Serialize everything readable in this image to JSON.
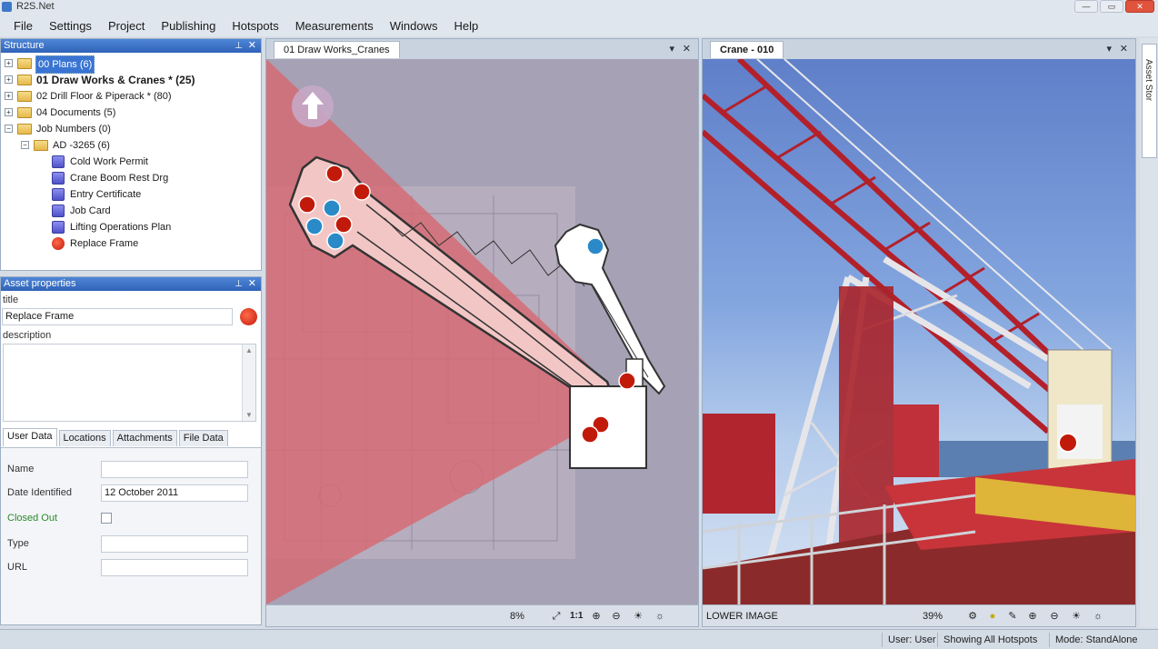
{
  "window": {
    "title": "R2S.Net",
    "minimize": "—",
    "maximize": "▭",
    "close": "✕"
  },
  "menu": [
    "File",
    "Settings",
    "Project",
    "Publishing",
    "Hotspots",
    "Measurements",
    "Windows",
    "Help"
  ],
  "structure": {
    "title": "Structure",
    "items": [
      {
        "label": "00 Plans (6)",
        "selected": true
      },
      {
        "label": "01 Draw Works & Cranes * (25)",
        "bold": true
      },
      {
        "label": "02 Drill Floor & Piperack * (80)"
      },
      {
        "label": "04 Documents (5)"
      },
      {
        "label": "Job Numbers (0)"
      },
      {
        "label": "AD -3265 (6)"
      },
      {
        "label": "Cold Work Permit"
      },
      {
        "label": "Crane Boom Rest Drg"
      },
      {
        "label": "Entry Certificate"
      },
      {
        "label": "Job Card"
      },
      {
        "label": "Lifting Operations Plan"
      },
      {
        "label": "Replace Frame"
      }
    ]
  },
  "asset_properties": {
    "title": "Asset properties",
    "title_label": "title",
    "title_value": "Replace Frame",
    "description_label": "description",
    "tabs": [
      "User Data",
      "Locations",
      "Attachments",
      "File Data"
    ],
    "fields": {
      "name_label": "Name",
      "name_value": "",
      "date_label": "Date Identified",
      "date_value": "12 October 2011",
      "closed_label": "Closed Out",
      "type_label": "Type",
      "type_value": "",
      "url_label": "URL",
      "url_value": ""
    }
  },
  "plan_view": {
    "tab": "01 Draw Works_Cranes",
    "zoom": "8%",
    "scale_label": "1:1",
    "dropdown": "▾",
    "close": "✕"
  },
  "photo_view": {
    "tab": "Crane - 010",
    "image_label": "LOWER IMAGE",
    "zoom": "39%",
    "dropdown": "▾",
    "close": "✕"
  },
  "side_tab": {
    "label": "Asset Stor"
  },
  "status": {
    "user": "User: User",
    "hotspots": "Showing All Hotspots",
    "mode": "Mode: StandAlone"
  },
  "colors": {
    "panel_header": "#2f63b8",
    "hotspot_red": "#c21a0a",
    "hotspot_blue": "#2a8ac8",
    "cone": "#d9676e"
  }
}
